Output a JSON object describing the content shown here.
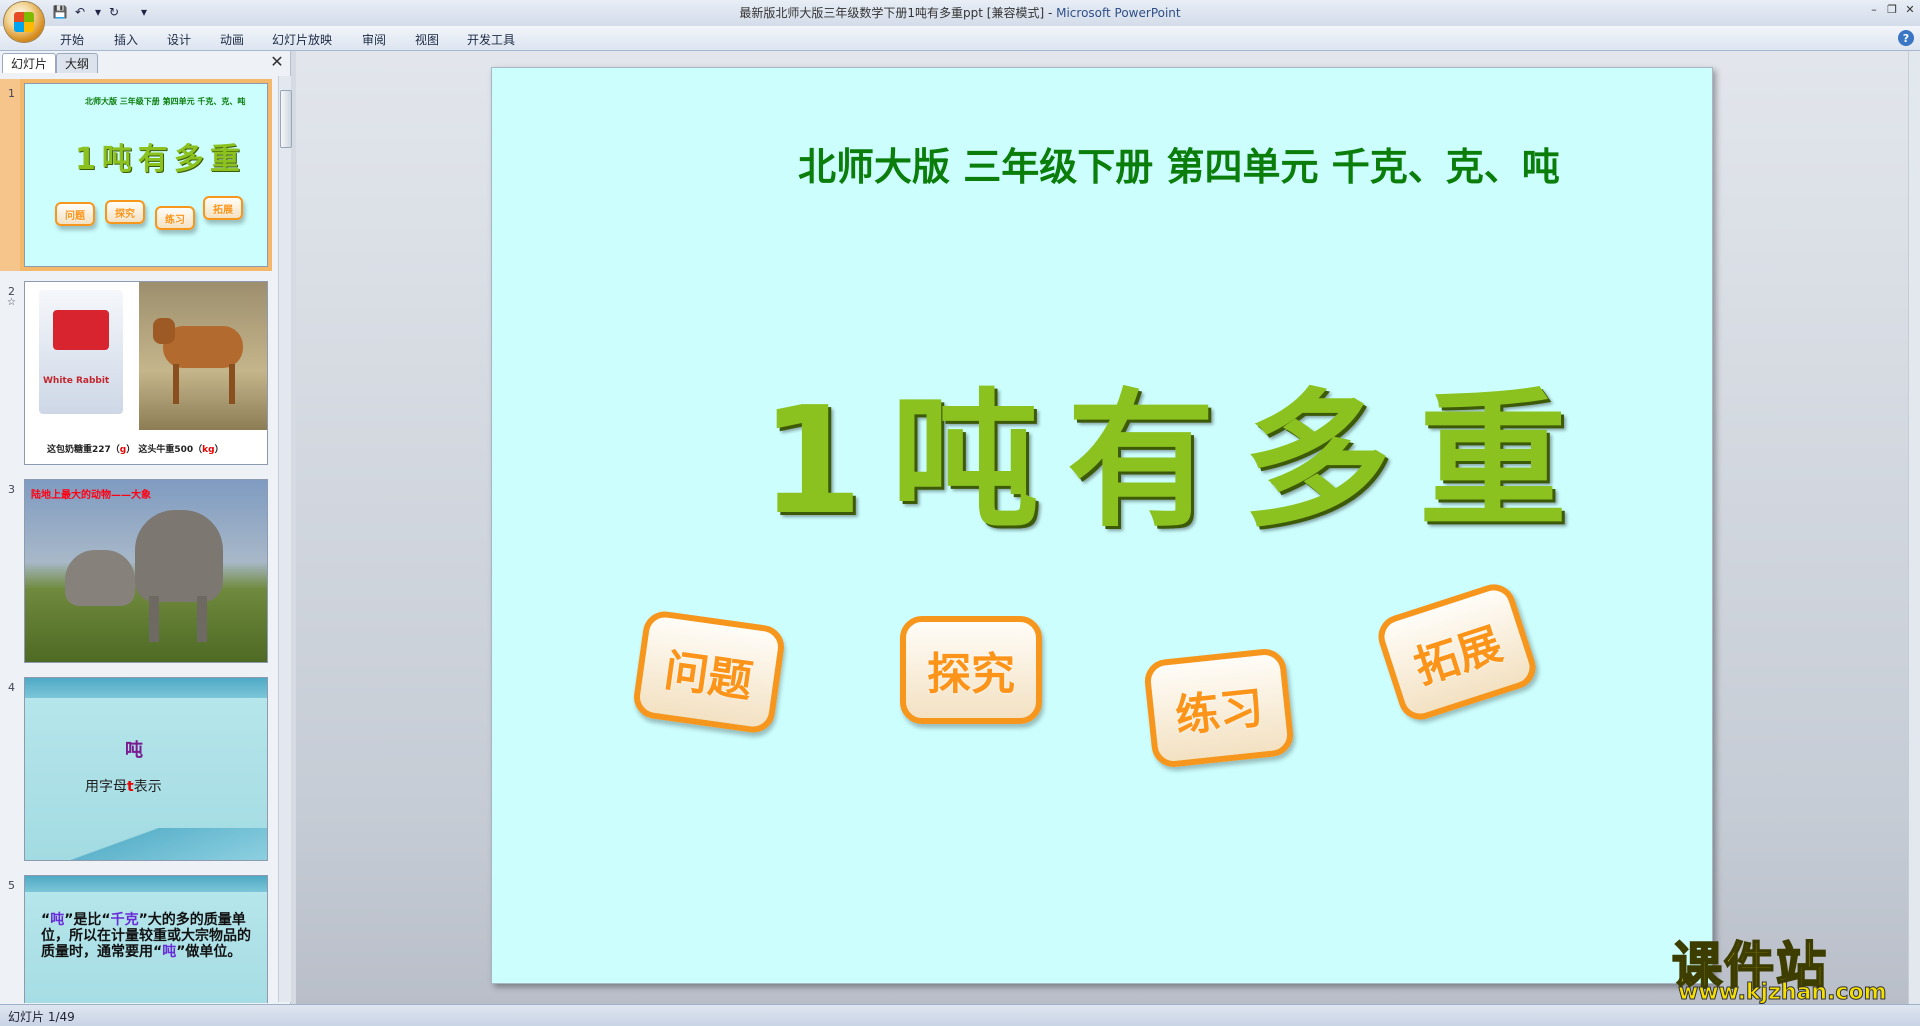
{
  "window": {
    "title": "最新版北师大版三年级数学下册1吨有多重ppt [兼容模式]",
    "separator": " - ",
    "app_name": "Microsoft PowerPoint"
  },
  "quick_access": {
    "save": "💾",
    "undo": "↶",
    "redo": "↻",
    "more": "▾"
  },
  "window_controls": {
    "minimize": "–",
    "restore": "❐",
    "close": "✕"
  },
  "ribbon_tabs": [
    "开始",
    "插入",
    "设计",
    "动画",
    "幻灯片放映",
    "审阅",
    "视图",
    "开发工具"
  ],
  "help": "?",
  "pane": {
    "tab_slides": "幻灯片",
    "tab_outline": "大纲",
    "close": "✕"
  },
  "thumbnails": {
    "t1": {
      "num": "1",
      "subtitle": "北师大版  三年级下册  第四单元  千克、克、吨",
      "title": "1吨有多重",
      "buttons": [
        "问题",
        "探究",
        "练习",
        "拓展"
      ]
    },
    "t2": {
      "num": "2",
      "star": "☆",
      "package": "White Rabbit",
      "caption_a": "这包奶糖重227（",
      "unit_a": "g",
      "caption_mid": "）   这头牛重500（",
      "unit_b": "kg",
      "caption_end": "）"
    },
    "t3": {
      "num": "3",
      "caption": "陆地上最大的动物——大象"
    },
    "t4": {
      "num": "4",
      "word": "吨",
      "line_a": "用字母",
      "letter": "t",
      "line_b": "表示"
    },
    "t5": {
      "num": "5",
      "q1": "“",
      "w1": "吨",
      "q2": "”是比“",
      "w2": "千克",
      "q3": "”大的多的质量单位，所以在计量较重或大宗物品的质量时，通常要用“",
      "w3": "吨",
      "q4": "”做单位。"
    }
  },
  "slide": {
    "subtitle": "北师大版  三年级下册  第四单元  千克、克、吨",
    "title": "1吨有多重",
    "buttons": [
      "问题",
      "探究",
      "练习",
      "拓展"
    ]
  },
  "watermark": {
    "title": "课件站",
    "url": "www.kjzhan.com"
  },
  "status": {
    "text": "幻灯片 1/49"
  },
  "colors": {
    "slide_bg": "#ccfefe",
    "subtitle": "#0a7d0a",
    "title": "#8cc21f",
    "button": "#f7961d"
  }
}
